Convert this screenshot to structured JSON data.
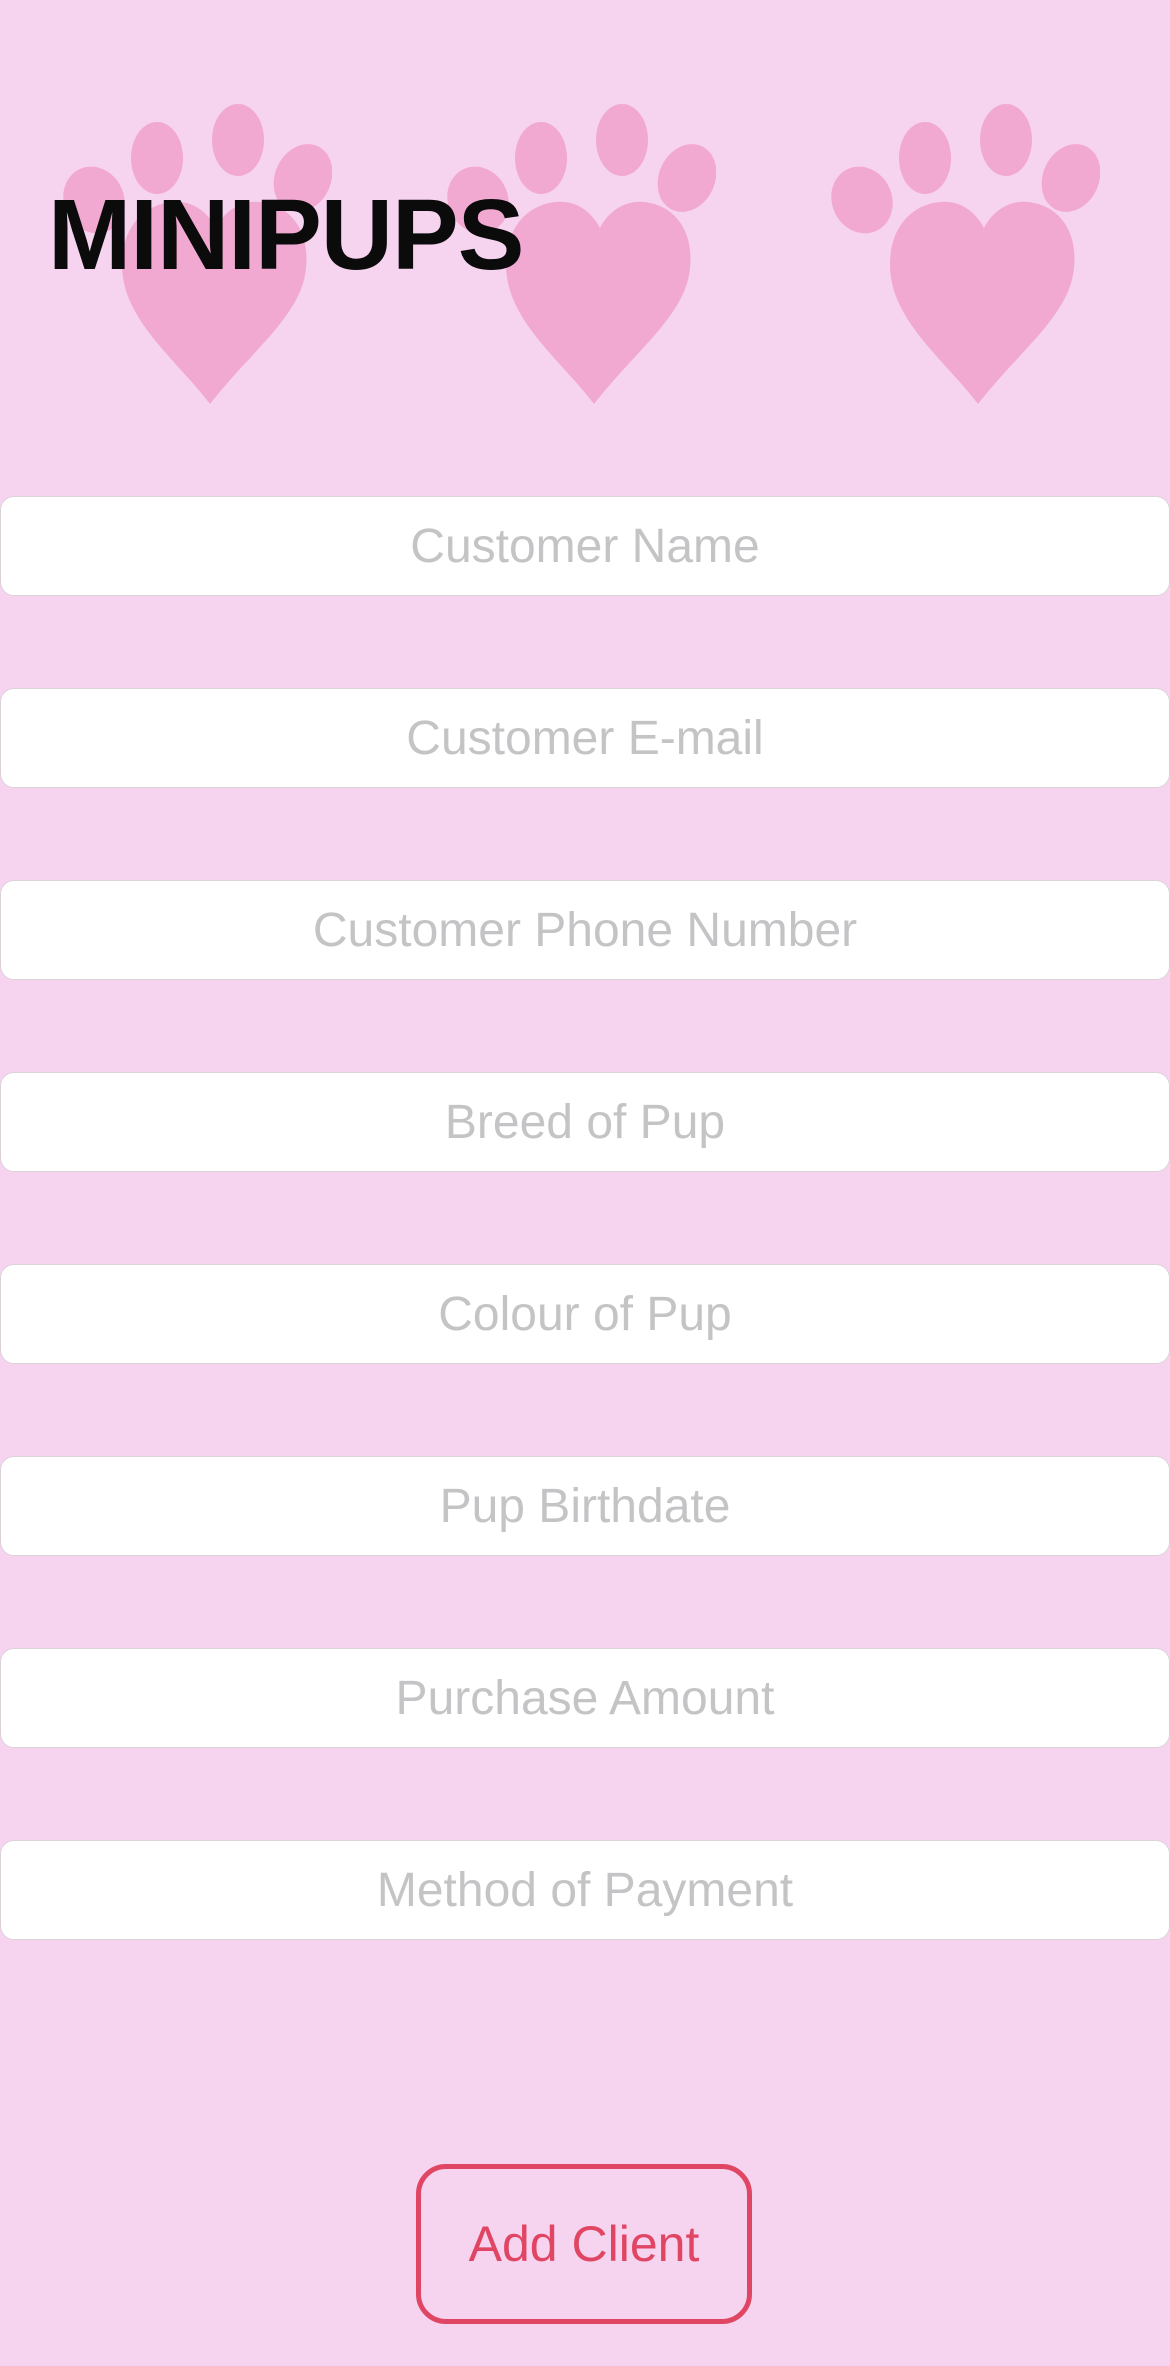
{
  "app_title": "MINIPUPS",
  "colors": {
    "background": "#f6d3ef",
    "paw": "#f2a9d1",
    "accent": "#e04663",
    "placeholder": "#c4c4c6"
  },
  "header": {
    "decorations": [
      "paw-heart-icon",
      "paw-heart-icon",
      "paw-heart-icon"
    ]
  },
  "form": {
    "fields": [
      {
        "placeholder": "Customer Name",
        "value": ""
      },
      {
        "placeholder": "Customer E-mail",
        "value": ""
      },
      {
        "placeholder": "Customer Phone Number",
        "value": ""
      },
      {
        "placeholder": "Breed of Pup",
        "value": ""
      },
      {
        "placeholder": "Colour of Pup",
        "value": ""
      },
      {
        "placeholder": "Pup Birthdate",
        "value": ""
      },
      {
        "placeholder": "Purchase Amount",
        "value": ""
      },
      {
        "placeholder": "Method of Payment",
        "value": ""
      }
    ],
    "submit_label": "Add Client"
  }
}
